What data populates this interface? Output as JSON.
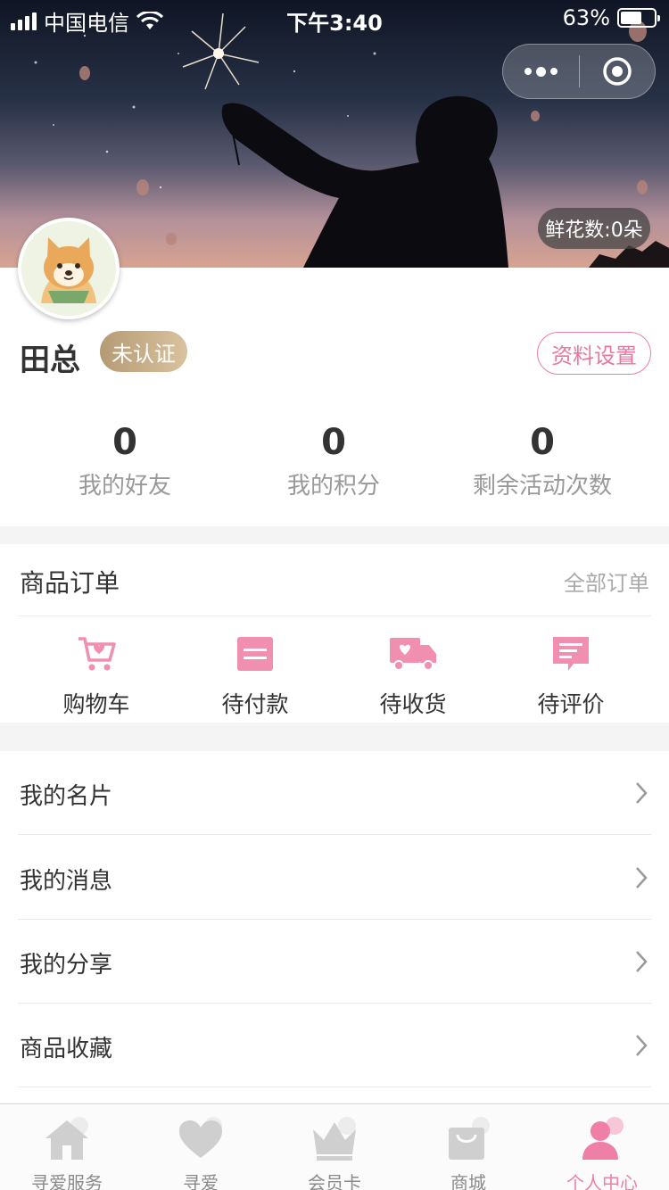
{
  "statusbar": {
    "carrier": "中国电信",
    "time": "下午3:40",
    "battery": "63%",
    "battery_level": 0.63
  },
  "capsule": {
    "more_icon": "more-dots-icon",
    "close_icon": "target-icon"
  },
  "banner": {
    "flowers": "鲜花数:0朵"
  },
  "profile": {
    "name": "田总",
    "badge": "未认证",
    "settings": "资料设置",
    "stats": [
      {
        "value": "0",
        "label": "我的好友"
      },
      {
        "value": "0",
        "label": "我的积分"
      },
      {
        "value": "0",
        "label": "剩余活动次数"
      }
    ]
  },
  "orders": {
    "title": "商品订单",
    "all": "全部订单",
    "items": [
      {
        "label": "购物车",
        "icon": "shopping-cart-icon"
      },
      {
        "label": "待付款",
        "icon": "payment-card-icon"
      },
      {
        "label": "待收货",
        "icon": "delivery-truck-icon"
      },
      {
        "label": "待评价",
        "icon": "comment-icon"
      }
    ]
  },
  "menu": [
    {
      "label": "我的名片"
    },
    {
      "label": "我的消息"
    },
    {
      "label": "我的分享"
    },
    {
      "label": "商品收藏"
    }
  ],
  "tabbar": [
    {
      "label": "寻爱服务",
      "icon": "home-icon"
    },
    {
      "label": "寻爱",
      "icon": "heart-icon"
    },
    {
      "label": "会员卡",
      "icon": "crown-icon"
    },
    {
      "label": "商城",
      "icon": "shopping-bag-icon"
    },
    {
      "label": "个人中心",
      "icon": "person-icon",
      "active": true
    }
  ],
  "colors": {
    "accent": "#ef7fa6",
    "badge_gold": "#c7ad86",
    "text": "#333333",
    "muted": "#999999"
  }
}
